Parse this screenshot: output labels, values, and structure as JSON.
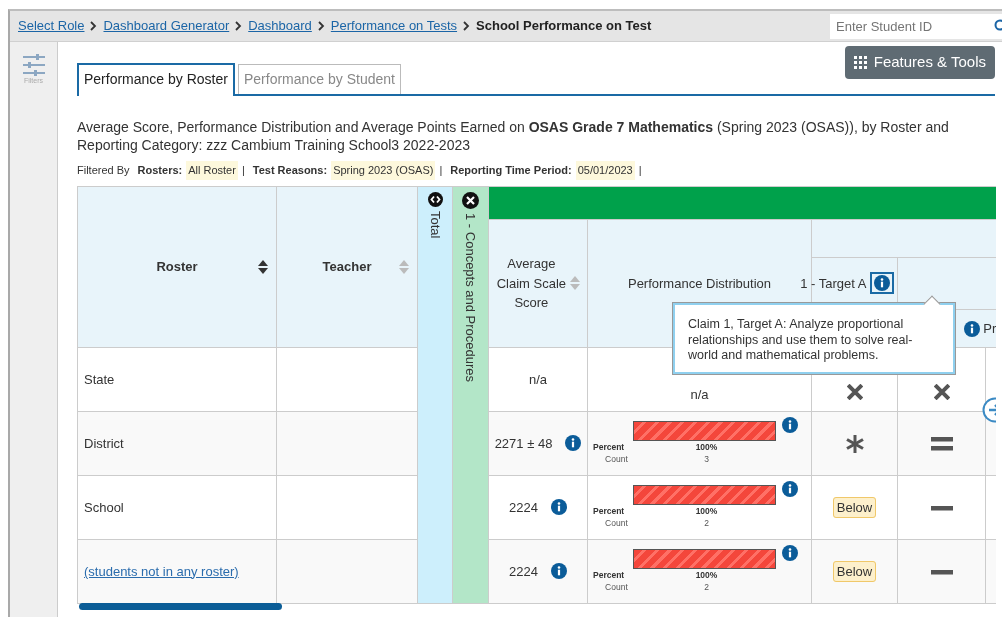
{
  "breadcrumb": [
    {
      "label": "Select Role",
      "current": false
    },
    {
      "label": "Dashboard Generator",
      "current": false
    },
    {
      "label": "Dashboard",
      "current": false
    },
    {
      "label": "Performance on Tests",
      "current": false
    },
    {
      "label": "School Performance on Test",
      "current": true
    }
  ],
  "student_search": {
    "placeholder": "Enter Student ID"
  },
  "sidebar": {
    "filters_label": "Filters"
  },
  "tabs": [
    {
      "label": "Performance by Roster",
      "selected": true
    },
    {
      "label": "Performance by Student",
      "selected": false
    }
  ],
  "features_button": "Features & Tools",
  "title": "Average Score, Performance Distribution and Average Points Earned on **OSAS Grade 7 Mathematics** (Spring 2023 (OSAS)), by Roster and Reporting Category: zzz Cambium Training School3 2022-2023",
  "filters": {
    "label": "Filtered By",
    "separator": "|",
    "items": [
      {
        "name": "Rosters:",
        "value": "All Roster"
      },
      {
        "name": "Test Reasons:",
        "value": "Spring 2023 (OSAS)"
      },
      {
        "name": "Reporting Time Period:",
        "value": "05/01/2023"
      }
    ]
  },
  "table": {
    "columns": [
      {
        "label": "Roster",
        "sortable": true,
        "sorted": true
      },
      {
        "label": "Teacher",
        "sortable": true,
        "sorted": false
      }
    ],
    "claims": [
      {
        "label": "Total",
        "expanded": false
      },
      {
        "label": "1 - Concepts and Procedures",
        "expanded": true
      }
    ],
    "avg_header": {
      "label": "Average Claim Scale Score",
      "sortable": true
    },
    "dist_header": "Performance Distribution",
    "targets": [
      {
        "label": "1 - Target A",
        "info": true,
        "focused": true
      },
      {
        "label": "Pr",
        "info": true,
        "focused": false
      }
    ],
    "rows": [
      {
        "roster": "State",
        "kind": "text",
        "avg": "n/a",
        "avg_info": false,
        "dist": {
          "kind": "text",
          "text": "n/a"
        },
        "marks": [
          {
            "kind": "times"
          },
          {
            "kind": "times"
          }
        ]
      },
      {
        "roster": "District",
        "kind": "text",
        "avg": "2271 ± 48",
        "avg_info": true,
        "dist": {
          "kind": "bar",
          "level": 1,
          "percent_label": "Percent",
          "percent": "100%",
          "count_label": "Count",
          "count": "3"
        },
        "marks": [
          {
            "kind": "asterisk"
          },
          {
            "kind": "equals"
          }
        ]
      },
      {
        "roster": "School",
        "kind": "text",
        "avg": "2224",
        "avg_info": true,
        "dist": {
          "kind": "bar",
          "level": 1,
          "percent_label": "Percent",
          "percent": "100%",
          "count_label": "Count",
          "count": "2"
        },
        "marks": [
          {
            "kind": "badge",
            "label": "Below"
          },
          {
            "kind": "minus"
          }
        ]
      },
      {
        "roster": "(students not in any roster)",
        "kind": "link",
        "avg": "2224",
        "avg_info": true,
        "dist": {
          "kind": "bar",
          "level": 1,
          "percent_label": "Percent",
          "percent": "100%",
          "count_label": "Count",
          "count": "2"
        },
        "marks": [
          {
            "kind": "badge",
            "label": "Below"
          },
          {
            "kind": "minus"
          }
        ]
      }
    ]
  },
  "tooltip": "Claim 1, Target A: Analyze proportional relationships and use them to solve real-world and mathematical problems."
}
